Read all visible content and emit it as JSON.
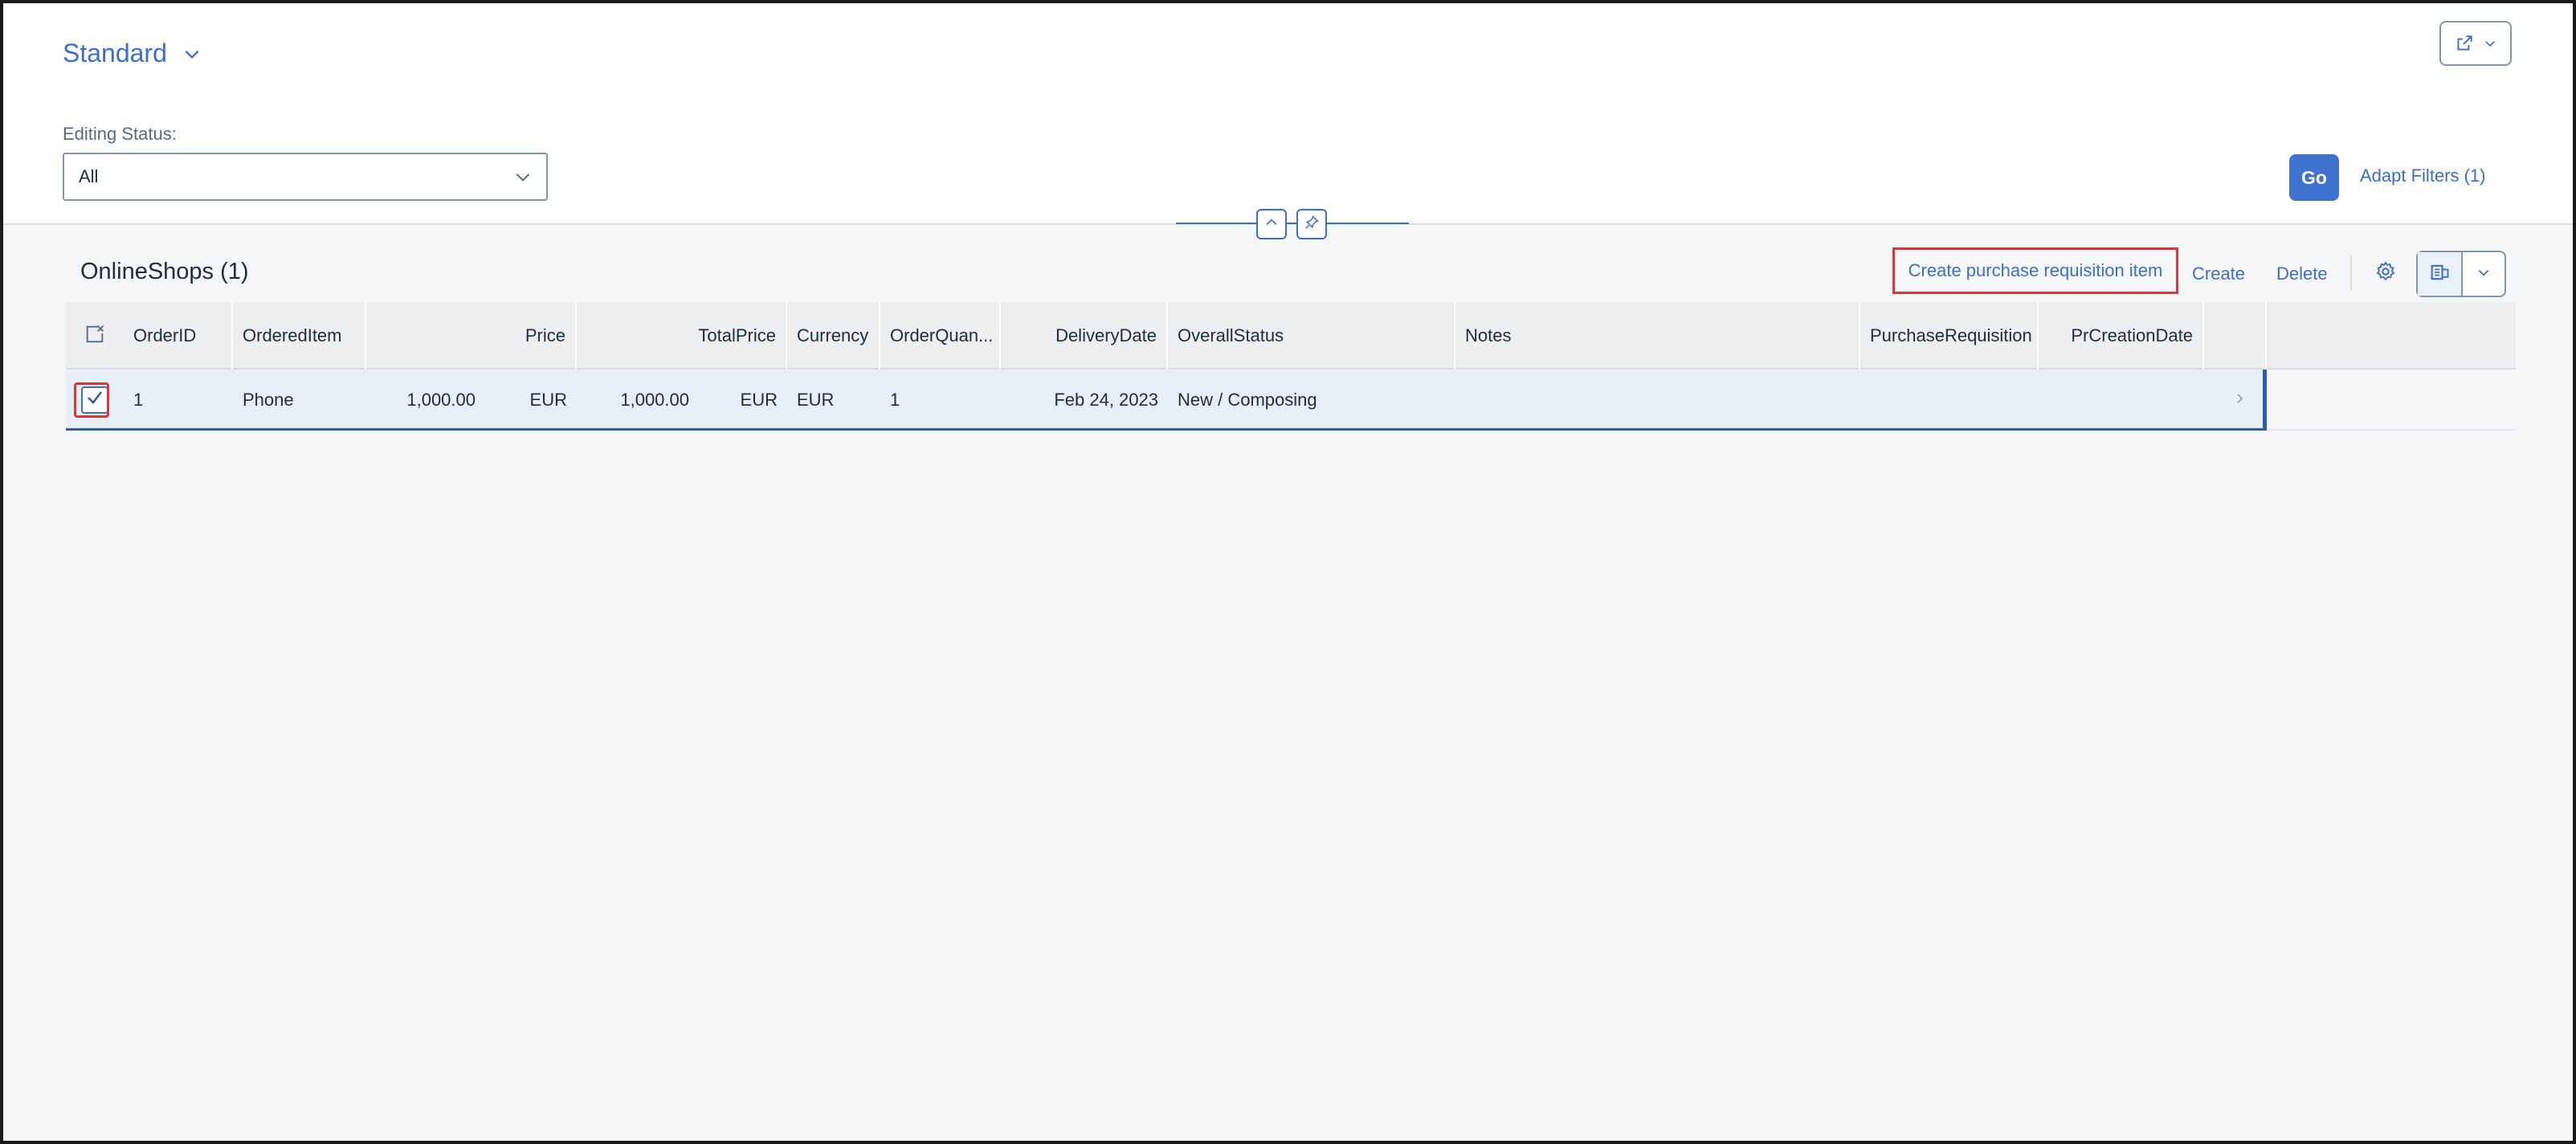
{
  "variant": {
    "title": "Standard"
  },
  "filter": {
    "label": "Editing Status:",
    "value": "All"
  },
  "actions": {
    "go": "Go",
    "adapt_filters": "Adapt Filters (1)"
  },
  "table": {
    "title": "OnlineShops (1)",
    "toolbar": {
      "create_pr": "Create purchase requisition item",
      "create": "Create",
      "delete": "Delete"
    },
    "columns": [
      "OrderID",
      "OrderedItem",
      "Price",
      "TotalPrice",
      "Currency",
      "OrderQuan...",
      "DeliveryDate",
      "OverallStatus",
      "Notes",
      "PurchaseRequisition",
      "PrCreationDate"
    ],
    "rows": [
      {
        "order_id": "1",
        "ordered_item": "Phone",
        "price": "1,000.00",
        "price_currency": "EUR",
        "total_price": "1,000.00",
        "total_currency": "EUR",
        "currency": "EUR",
        "order_quantity": "1",
        "delivery_date": "Feb 24, 2023",
        "overall_status": "New / Composing",
        "notes": "",
        "purchase_requisition": "",
        "pr_creation_date": "",
        "selected": true
      }
    ]
  },
  "colors": {
    "accent": "#3d6ec8",
    "go_button": "#3e73d0",
    "highlight_outline": "#d9383a",
    "selected_row": "#e8eef8"
  },
  "icons": [
    "chevron-down-icon",
    "share-icon",
    "collapse-up-icon",
    "pin-icon",
    "settings-icon",
    "export-icon",
    "clear-selection-icon",
    "checkmark-icon",
    "chevron-right-icon"
  ]
}
